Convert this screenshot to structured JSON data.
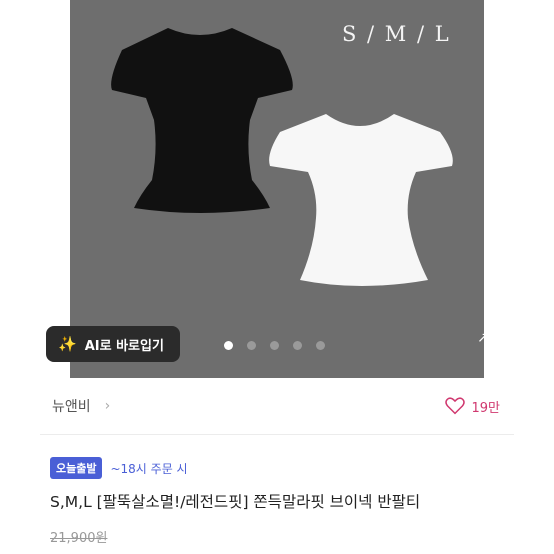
{
  "hero": {
    "size_label": "S / M / L",
    "ai_button_label": "AI로 바로입기",
    "carousel": {
      "count": 5,
      "active_index": 0
    }
  },
  "seller": {
    "name": "뉴앤비",
    "likes": "19만"
  },
  "delivery_badge": {
    "label": "오늘출발",
    "note": "~18시 주문 시"
  },
  "product": {
    "title": "S,M,L [팔뚝살소멸!/레전드핏] 쫀득말라핏 브이넥 반팔티",
    "original_price": "21,900원"
  },
  "colors": {
    "accent": "#4a5fd6",
    "like": "#d0386f",
    "photo_bg": "#6e6e6e"
  }
}
